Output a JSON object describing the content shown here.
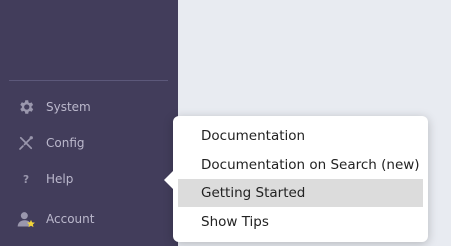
{
  "sidebar": {
    "items": [
      {
        "label": "System",
        "icon": "gear-icon"
      },
      {
        "label": "Config",
        "icon": "tools-icon"
      },
      {
        "label": "Help",
        "icon": "question-icon"
      },
      {
        "label": "Account",
        "icon": "user-star-icon"
      }
    ]
  },
  "help_menu": {
    "items": [
      {
        "label": "Documentation"
      },
      {
        "label": "Documentation on Search (new)"
      },
      {
        "label": "Getting Started",
        "highlighted": true
      },
      {
        "label": "Show Tips"
      }
    ]
  },
  "colors": {
    "sidebar_bg": "#423d5b",
    "sidebar_text": "#bbb8cc",
    "highlight": "#dcdcdc",
    "star": "#f2d43a"
  }
}
